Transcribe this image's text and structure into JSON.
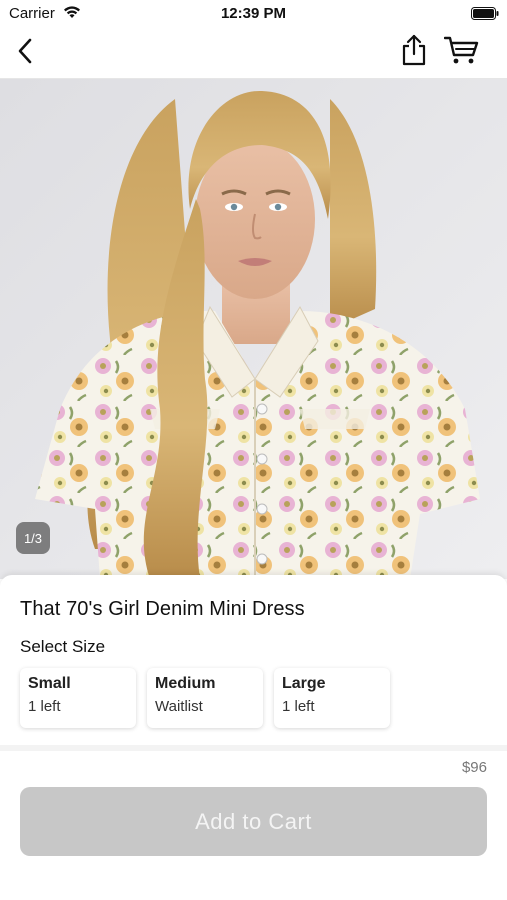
{
  "status_bar": {
    "carrier": "Carrier",
    "time": "12:39 PM",
    "icons": [
      "wifi-icon",
      "battery-icon"
    ]
  },
  "nav": {
    "icons": [
      "back-chevron-icon",
      "share-icon",
      "cart-icon"
    ]
  },
  "gallery": {
    "counter": "1/3",
    "current_image": 1,
    "total_images": 3
  },
  "product": {
    "title": "That 70's Girl Denim Mini Dress",
    "size_heading": "Select Size",
    "sizes": [
      {
        "name": "Small",
        "stock": "1 left"
      },
      {
        "name": "Medium",
        "stock": "Waitlist"
      },
      {
        "name": "Large",
        "stock": "1 left"
      }
    ],
    "price": "$96",
    "add_to_cart_label": "Add to Cart"
  },
  "colors": {
    "button_disabled_bg": "#c7c7c7",
    "button_text": "#f4f4f4",
    "price_text": "#777777",
    "image_background": "#e9e9ec"
  }
}
